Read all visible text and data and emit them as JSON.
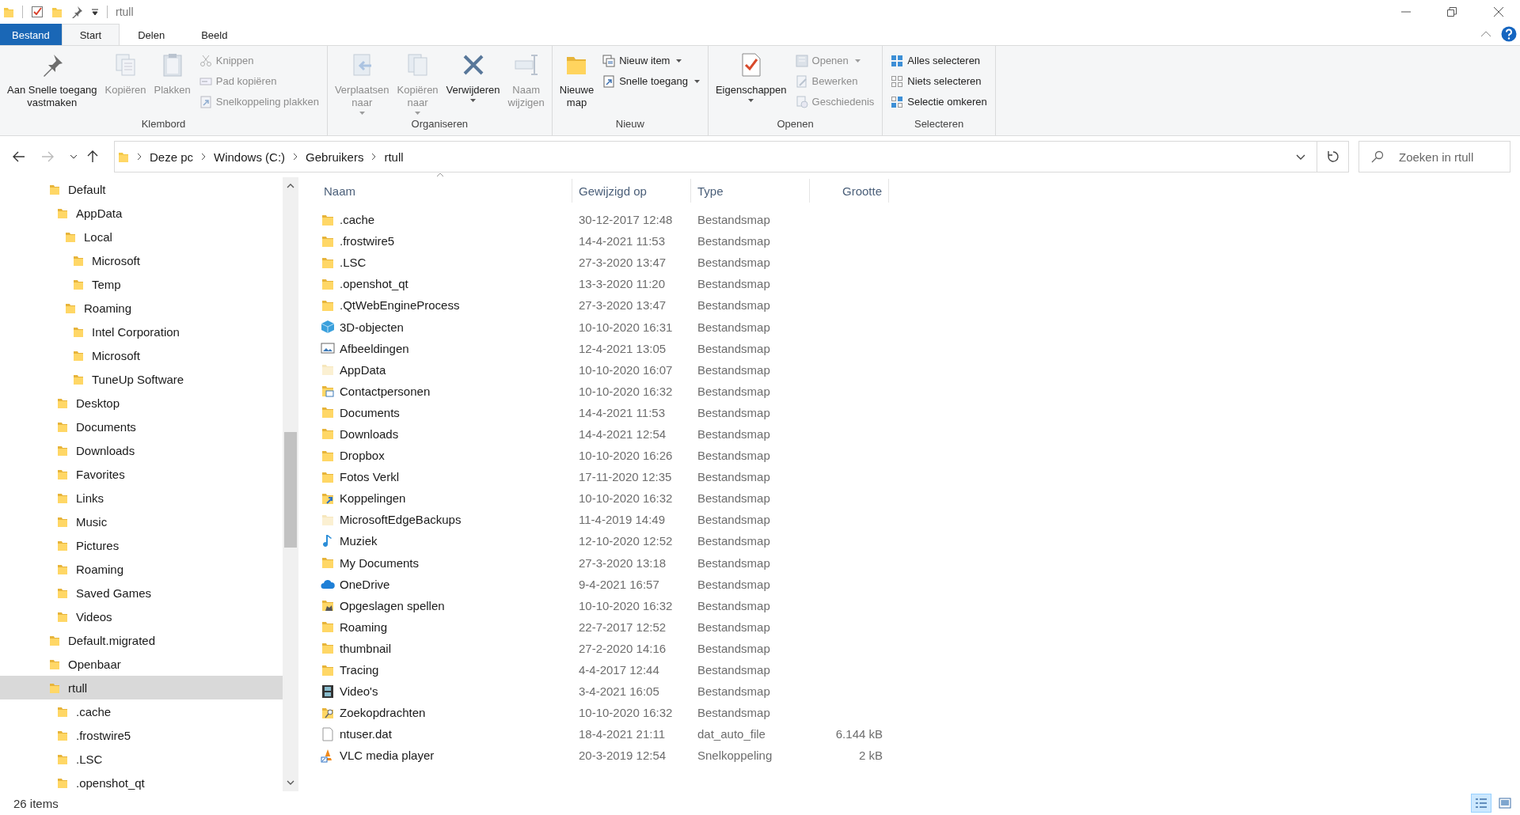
{
  "window": {
    "title": "rtull"
  },
  "ribbon_tabs": [
    {
      "label": "Bestand",
      "kind": "file",
      "selected": false
    },
    {
      "label": "Start",
      "kind": "tab",
      "selected": true
    },
    {
      "label": "Delen",
      "kind": "tab",
      "selected": false
    },
    {
      "label": "Beeld",
      "kind": "tab",
      "selected": false
    }
  ],
  "ribbon_groups": [
    {
      "label": "Klembord",
      "columns": [
        {
          "kind": "large",
          "lines": [
            "Aan Snelle toegang",
            "vastmaken"
          ],
          "disabled": false,
          "dropdown": false
        },
        {
          "kind": "large",
          "lines": [
            "Kopiëren"
          ],
          "disabled": true,
          "dropdown": false
        },
        {
          "kind": "large",
          "lines": [
            "Plakken"
          ],
          "disabled": true,
          "dropdown": false
        },
        {
          "kind": "stack",
          "items": [
            {
              "label": "Knippen",
              "disabled": true,
              "dropdown": false
            },
            {
              "label": "Pad kopiëren",
              "disabled": true,
              "dropdown": false
            },
            {
              "label": "Snelkoppeling plakken",
              "disabled": true,
              "dropdown": false
            }
          ]
        }
      ]
    },
    {
      "label": "Organiseren",
      "columns": [
        {
          "kind": "large",
          "lines": [
            "Verplaatsen",
            "naar"
          ],
          "disabled": true,
          "dropdown": true
        },
        {
          "kind": "large",
          "lines": [
            "Kopiëren",
            "naar"
          ],
          "disabled": true,
          "dropdown": true
        },
        {
          "kind": "large",
          "lines": [
            "Verwijderen"
          ],
          "disabled": false,
          "dropdown": true
        },
        {
          "kind": "large",
          "lines": [
            "Naam",
            "wijzigen"
          ],
          "disabled": true,
          "dropdown": false
        }
      ]
    },
    {
      "label": "Nieuw",
      "columns": [
        {
          "kind": "large",
          "lines": [
            "Nieuwe",
            "map"
          ],
          "disabled": false,
          "dropdown": false
        },
        {
          "kind": "stack",
          "items": [
            {
              "label": "Nieuw item",
              "disabled": false,
              "dropdown": true
            },
            {
              "label": "Snelle toegang",
              "disabled": false,
              "dropdown": true
            }
          ]
        }
      ]
    },
    {
      "label": "Openen",
      "columns": [
        {
          "kind": "large",
          "lines": [
            "Eigenschappen"
          ],
          "disabled": false,
          "dropdown": true
        },
        {
          "kind": "stack",
          "items": [
            {
              "label": "Openen",
              "disabled": true,
              "dropdown": true
            },
            {
              "label": "Bewerken",
              "disabled": true,
              "dropdown": false
            },
            {
              "label": "Geschiedenis",
              "disabled": true,
              "dropdown": false
            }
          ]
        }
      ]
    },
    {
      "label": "Selecteren",
      "columns": [
        {
          "kind": "stack",
          "items": [
            {
              "label": "Alles selecteren",
              "disabled": false,
              "dropdown": false
            },
            {
              "label": "Niets selecteren",
              "disabled": false,
              "dropdown": false
            },
            {
              "label": "Selectie omkeren",
              "disabled": false,
              "dropdown": false
            }
          ]
        }
      ]
    }
  ],
  "address_bar": {
    "forward_disabled": true,
    "path": [
      "Deze pc",
      "Windows (C:)",
      "Gebruikers",
      "rtull"
    ]
  },
  "search": {
    "placeholder": "Zoeken in rtull"
  },
  "nav_tree": [
    {
      "label": "Default",
      "selected": false,
      "children": [
        {
          "label": "AppData",
          "selected": false,
          "children": [
            {
              "label": "Local",
              "selected": false,
              "children": [
                {
                  "label": "Microsoft",
                  "selected": false
                },
                {
                  "label": "Temp",
                  "selected": false
                }
              ]
            },
            {
              "label": "Roaming",
              "selected": false,
              "children": [
                {
                  "label": "Intel Corporation",
                  "selected": false
                },
                {
                  "label": "Microsoft",
                  "selected": false
                },
                {
                  "label": "TuneUp Software",
                  "selected": false
                }
              ]
            }
          ]
        },
        {
          "label": "Desktop",
          "selected": false
        },
        {
          "label": "Documents",
          "selected": false
        },
        {
          "label": "Downloads",
          "selected": false
        },
        {
          "label": "Favorites",
          "selected": false
        },
        {
          "label": "Links",
          "selected": false
        },
        {
          "label": "Music",
          "selected": false
        },
        {
          "label": "Pictures",
          "selected": false
        },
        {
          "label": "Roaming",
          "selected": false
        },
        {
          "label": "Saved Games",
          "selected": false
        },
        {
          "label": "Videos",
          "selected": false
        }
      ]
    },
    {
      "label": "Default.migrated",
      "selected": false
    },
    {
      "label": "Openbaar",
      "selected": false
    },
    {
      "label": "rtull",
      "selected": true,
      "children": [
        {
          "label": ".cache",
          "selected": false
        },
        {
          "label": ".frostwire5",
          "selected": false
        },
        {
          "label": ".LSC",
          "selected": false
        },
        {
          "label": ".openshot_qt",
          "selected": false
        }
      ]
    }
  ],
  "file_list": {
    "columns": [
      "Naam",
      "Gewijzigd op",
      "Type",
      "Grootte"
    ],
    "rows": [
      {
        "name": ".cache",
        "modified": "30-12-2017 12:48",
        "type": "Bestandsmap",
        "kind": "folder",
        "selected": false
      },
      {
        "name": ".frostwire5",
        "modified": "14-4-2021 11:53",
        "type": "Bestandsmap",
        "kind": "folder",
        "selected": false
      },
      {
        "name": ".LSC",
        "modified": "27-3-2020 13:47",
        "type": "Bestandsmap",
        "kind": "folder",
        "selected": false
      },
      {
        "name": ".openshot_qt",
        "modified": "13-3-2020 11:20",
        "type": "Bestandsmap",
        "kind": "folder",
        "selected": false
      },
      {
        "name": ".QtWebEngineProcess",
        "modified": "27-3-2020 13:47",
        "type": "Bestandsmap",
        "kind": "folder",
        "selected": false
      },
      {
        "name": "3D-objecten",
        "modified": "10-10-2020 16:31",
        "type": "Bestandsmap",
        "kind": "cube",
        "selected": false
      },
      {
        "name": "Afbeeldingen",
        "modified": "12-4-2021 13:05",
        "type": "Bestandsmap",
        "kind": "picture",
        "selected": false
      },
      {
        "name": "AppData",
        "modified": "10-10-2020 16:07",
        "type": "Bestandsmap",
        "kind": "hidden-folder",
        "selected": false
      },
      {
        "name": "Contactpersonen",
        "modified": "10-10-2020 16:32",
        "type": "Bestandsmap",
        "kind": "contacts",
        "selected": false
      },
      {
        "name": "Documents",
        "modified": "14-4-2021 11:53",
        "type": "Bestandsmap",
        "kind": "folder",
        "selected": false
      },
      {
        "name": "Downloads",
        "modified": "14-4-2021 12:54",
        "type": "Bestandsmap",
        "kind": "folder",
        "selected": false
      },
      {
        "name": "Dropbox",
        "modified": "10-10-2020 16:26",
        "type": "Bestandsmap",
        "kind": "folder",
        "selected": false
      },
      {
        "name": "Fotos Verkl",
        "modified": "17-11-2020 12:35",
        "type": "Bestandsmap",
        "kind": "folder",
        "selected": false
      },
      {
        "name": "Koppelingen",
        "modified": "10-10-2020 16:32",
        "type": "Bestandsmap",
        "kind": "links",
        "selected": false
      },
      {
        "name": "MicrosoftEdgeBackups",
        "modified": "11-4-2019 14:49",
        "type": "Bestandsmap",
        "kind": "hidden-folder",
        "selected": false
      },
      {
        "name": "Muziek",
        "modified": "12-10-2020 12:52",
        "type": "Bestandsmap",
        "kind": "music",
        "selected": false
      },
      {
        "name": "My Documents",
        "modified": "27-3-2020 13:18",
        "type": "Bestandsmap",
        "kind": "folder",
        "selected": false
      },
      {
        "name": "OneDrive",
        "modified": "9-4-2021 16:57",
        "type": "Bestandsmap",
        "kind": "cloud",
        "selected": false
      },
      {
        "name": "Opgeslagen spellen",
        "modified": "10-10-2020 16:32",
        "type": "Bestandsmap",
        "kind": "games",
        "selected": false
      },
      {
        "name": "Roaming",
        "modified": "22-7-2017 12:52",
        "type": "Bestandsmap",
        "kind": "folder",
        "selected": false
      },
      {
        "name": "thumbnail",
        "modified": "27-2-2020 14:16",
        "type": "Bestandsmap",
        "kind": "folder",
        "selected": false
      },
      {
        "name": "Tracing",
        "modified": "4-4-2017 12:44",
        "type": "Bestandsmap",
        "kind": "folder",
        "selected": false
      },
      {
        "name": "Video's",
        "modified": "3-4-2021 16:05",
        "type": "Bestandsmap",
        "kind": "film",
        "selected": false
      },
      {
        "name": "Zoekopdrachten",
        "modified": "10-10-2020 16:32",
        "type": "Bestandsmap",
        "kind": "search",
        "selected": false
      },
      {
        "name": "ntuser.dat",
        "modified": "18-4-2021 21:11",
        "type": "dat_auto_file",
        "size": "6.144 kB",
        "kind": "file",
        "selected": false
      },
      {
        "name": "VLC media player",
        "modified": "20-3-2019 12:54",
        "type": "Snelkoppeling",
        "size": "2 kB",
        "kind": "shortcut",
        "selected": false
      }
    ]
  },
  "status_bar": {
    "item_count": "26 items"
  },
  "view_buttons": [
    {
      "kind": "details",
      "selected": true
    },
    {
      "kind": "large-icons",
      "selected": false
    }
  ]
}
